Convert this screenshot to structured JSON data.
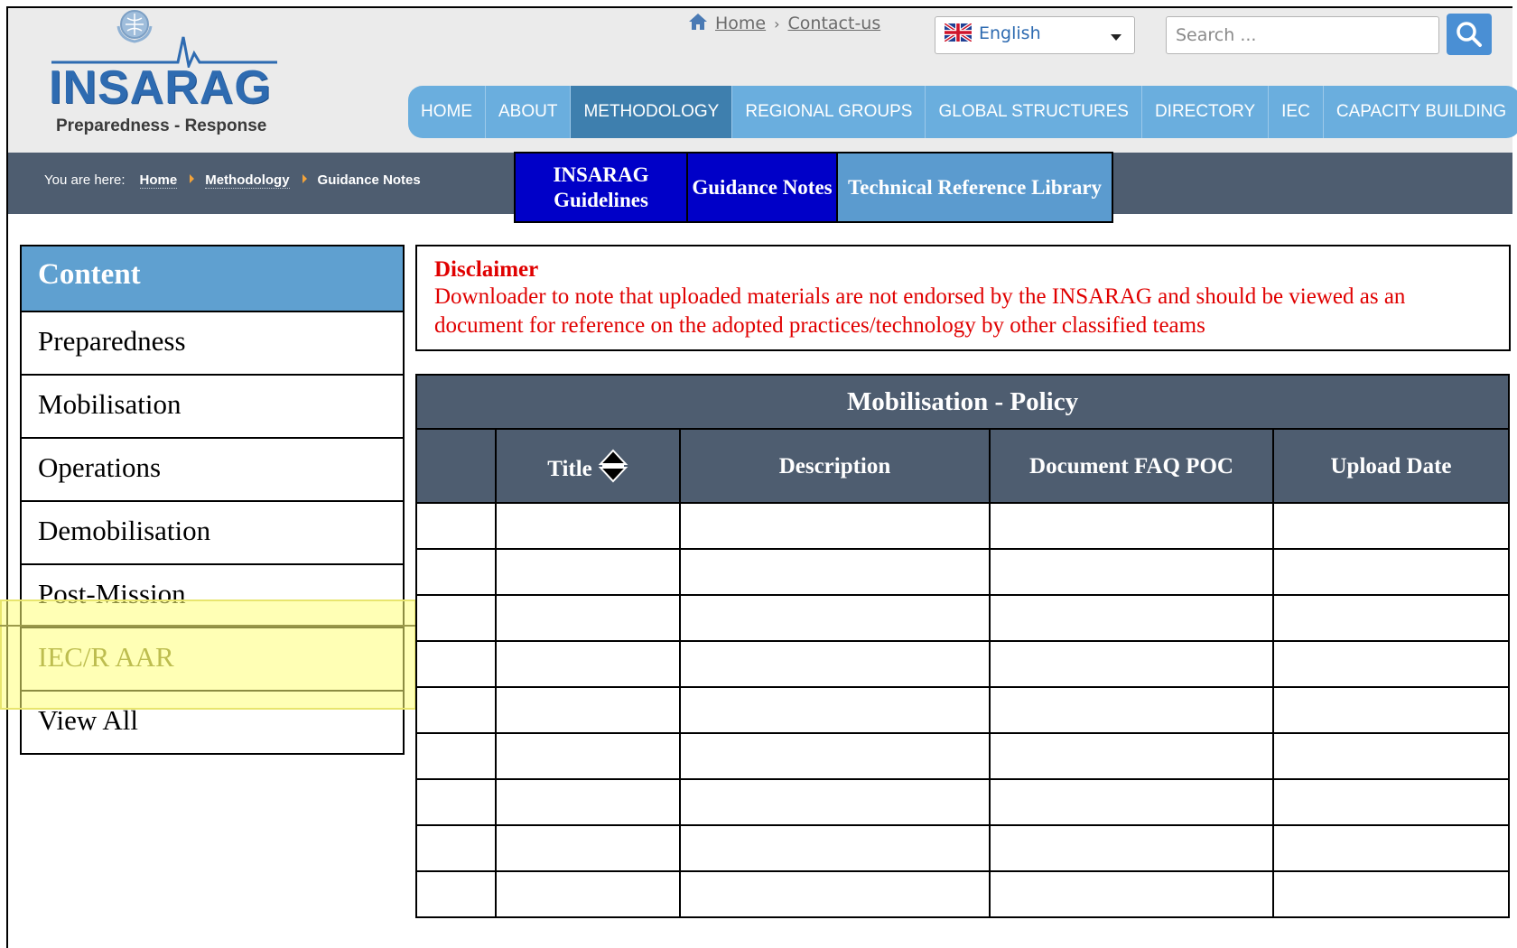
{
  "header": {
    "logo_text": "INSARAG",
    "tagline": "Preparedness - Response",
    "top_links": [
      "Home",
      "Contact-us"
    ],
    "top_links_separator": "›",
    "language": "English",
    "search_placeholder": "Search ...",
    "nav": [
      "HOME",
      "ABOUT",
      "METHODOLOGY",
      "REGIONAL GROUPS",
      "GLOBAL STRUCTURES",
      "DIRECTORY",
      "IEC",
      "CAPACITY BUILDING"
    ],
    "nav_active": "METHODOLOGY"
  },
  "breadcrumb": {
    "label": "You are here:",
    "items": [
      "Home",
      "Methodology",
      "Guidance Notes"
    ]
  },
  "sub_tabs": [
    "INSARAG Guidelines",
    "Guidance Notes",
    "Technical Reference Library"
  ],
  "content_panel": {
    "title": "Content",
    "items": [
      "Preparedness",
      "Mobilisation",
      "Operations",
      "Demobilisation",
      "Post-Mission",
      "IEC/R AAR",
      "View All"
    ],
    "highlighted": "IEC/R AAR"
  },
  "disclaimer": {
    "title": "Disclaimer",
    "text": "Downloader to note that uploaded materials are not endorsed by the INSARAG and should be viewed as an document for reference on the adopted practices/technology by other classified teams"
  },
  "table": {
    "caption": "Mobilisation - Policy",
    "columns": [
      "",
      "Title",
      "Description",
      "Document FAQ POC",
      "Upload Date"
    ],
    "empty_row_count": 9
  },
  "colors": {
    "header_bg": "#ebebeb",
    "nav_bg": "#6aaede",
    "nav_active": "#3e7fae",
    "dark_bar": "#4e5d70",
    "sub_tab_active": "#0000c8",
    "sub_tab_light": "#5b9bcf",
    "panel_head": "#5fa0d0",
    "disclaimer_text": "#e00000",
    "highlight": "#ffff78"
  },
  "icons": {
    "home_link": "home-icon",
    "language": "uk-flag-icon",
    "search": "search-icon",
    "dropdown": "caret-down-icon",
    "breadcrumb_sep": "arrow-right-icon",
    "sort": "sort-icon"
  }
}
